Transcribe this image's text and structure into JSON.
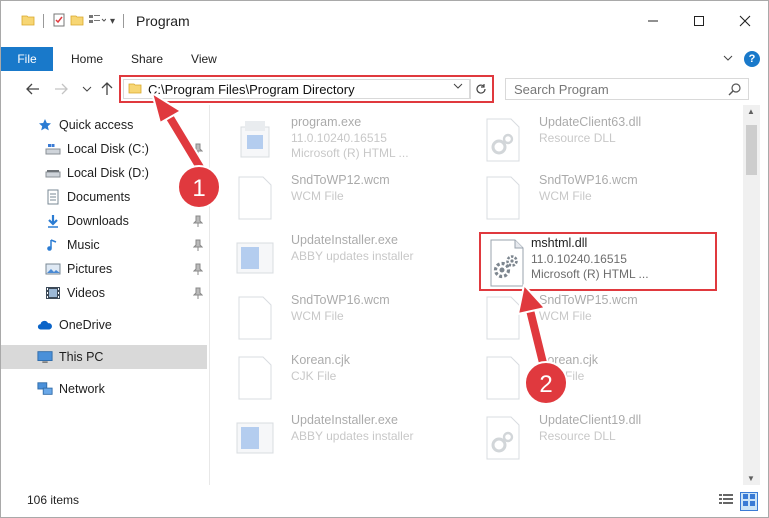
{
  "window": {
    "title": "Program",
    "accent": "#1979ca",
    "annotation_color": "#e0393e"
  },
  "ribbon": {
    "tabs": [
      "File",
      "Home",
      "Share",
      "View"
    ]
  },
  "address": {
    "path": "C:\\Program Files\\Program Directory"
  },
  "search": {
    "placeholder": "Search Program"
  },
  "sidebar": {
    "items": [
      {
        "label": "Quick access",
        "icon": "star-icon",
        "pinned": false
      },
      {
        "label": "Local Disk (C:)",
        "icon": "drive-icon",
        "pinned": true
      },
      {
        "label": "Local Disk (D:)",
        "icon": "drive-icon",
        "pinned": false
      },
      {
        "label": "Documents",
        "icon": "documents-icon",
        "pinned": true
      },
      {
        "label": "Downloads",
        "icon": "download-icon",
        "pinned": true
      },
      {
        "label": "Music",
        "icon": "music-icon",
        "pinned": true
      },
      {
        "label": "Pictures",
        "icon": "pictures-icon",
        "pinned": true
      },
      {
        "label": "Videos",
        "icon": "videos-icon",
        "pinned": true
      },
      {
        "label": "OneDrive",
        "icon": "cloud-icon",
        "pinned": false
      },
      {
        "label": "This PC",
        "icon": "computer-icon",
        "pinned": false,
        "selected": true
      },
      {
        "label": "Network",
        "icon": "network-icon",
        "pinned": false
      }
    ]
  },
  "files": [
    {
      "name": "program.exe",
      "line1": "11.0.10240.16515",
      "line2": "Microsoft (R) HTML ...",
      "icon": "installer-icon"
    },
    {
      "name": "UpdateClient63.dll",
      "line1": "Resource DLL",
      "line2": "",
      "icon": "dll-icon"
    },
    {
      "name": "SndToWP12.wcm",
      "line1": "WCM File",
      "line2": "",
      "icon": "document-icon"
    },
    {
      "name": "SndToWP16.wcm",
      "line1": "WCM File",
      "line2": "",
      "icon": "document-icon"
    },
    {
      "name": "UpdateInstaller.exe",
      "line1": "ABBY updates installer",
      "line2": "",
      "icon": "installer-icon"
    },
    {
      "name": "mshtml.dll",
      "line1": "11.0.10240.16515",
      "line2": "Microsoft (R) HTML ...",
      "icon": "dll-icon",
      "highlighted": true
    },
    {
      "name": "SndToWP16.wcm",
      "line1": "WCM File",
      "line2": "",
      "icon": "document-icon"
    },
    {
      "name": "SndToWP15.wcm",
      "line1": "WCM File",
      "line2": "",
      "icon": "document-icon"
    },
    {
      "name": "Korean.cjk",
      "line1": "CJK File",
      "line2": "",
      "icon": "document-icon"
    },
    {
      "name": "Korean.cjk",
      "line1": "CJK File",
      "line2": "",
      "icon": "document-icon"
    },
    {
      "name": "UpdateInstaller.exe",
      "line1": "ABBY updates installer",
      "line2": "",
      "icon": "installer-icon"
    },
    {
      "name": "UpdateClient19.dll",
      "line1": "Resource DLL",
      "line2": "",
      "icon": "dll-icon"
    }
  ],
  "status": {
    "items_count": "106 items"
  },
  "annotations": {
    "step1": "1",
    "step2": "2"
  }
}
